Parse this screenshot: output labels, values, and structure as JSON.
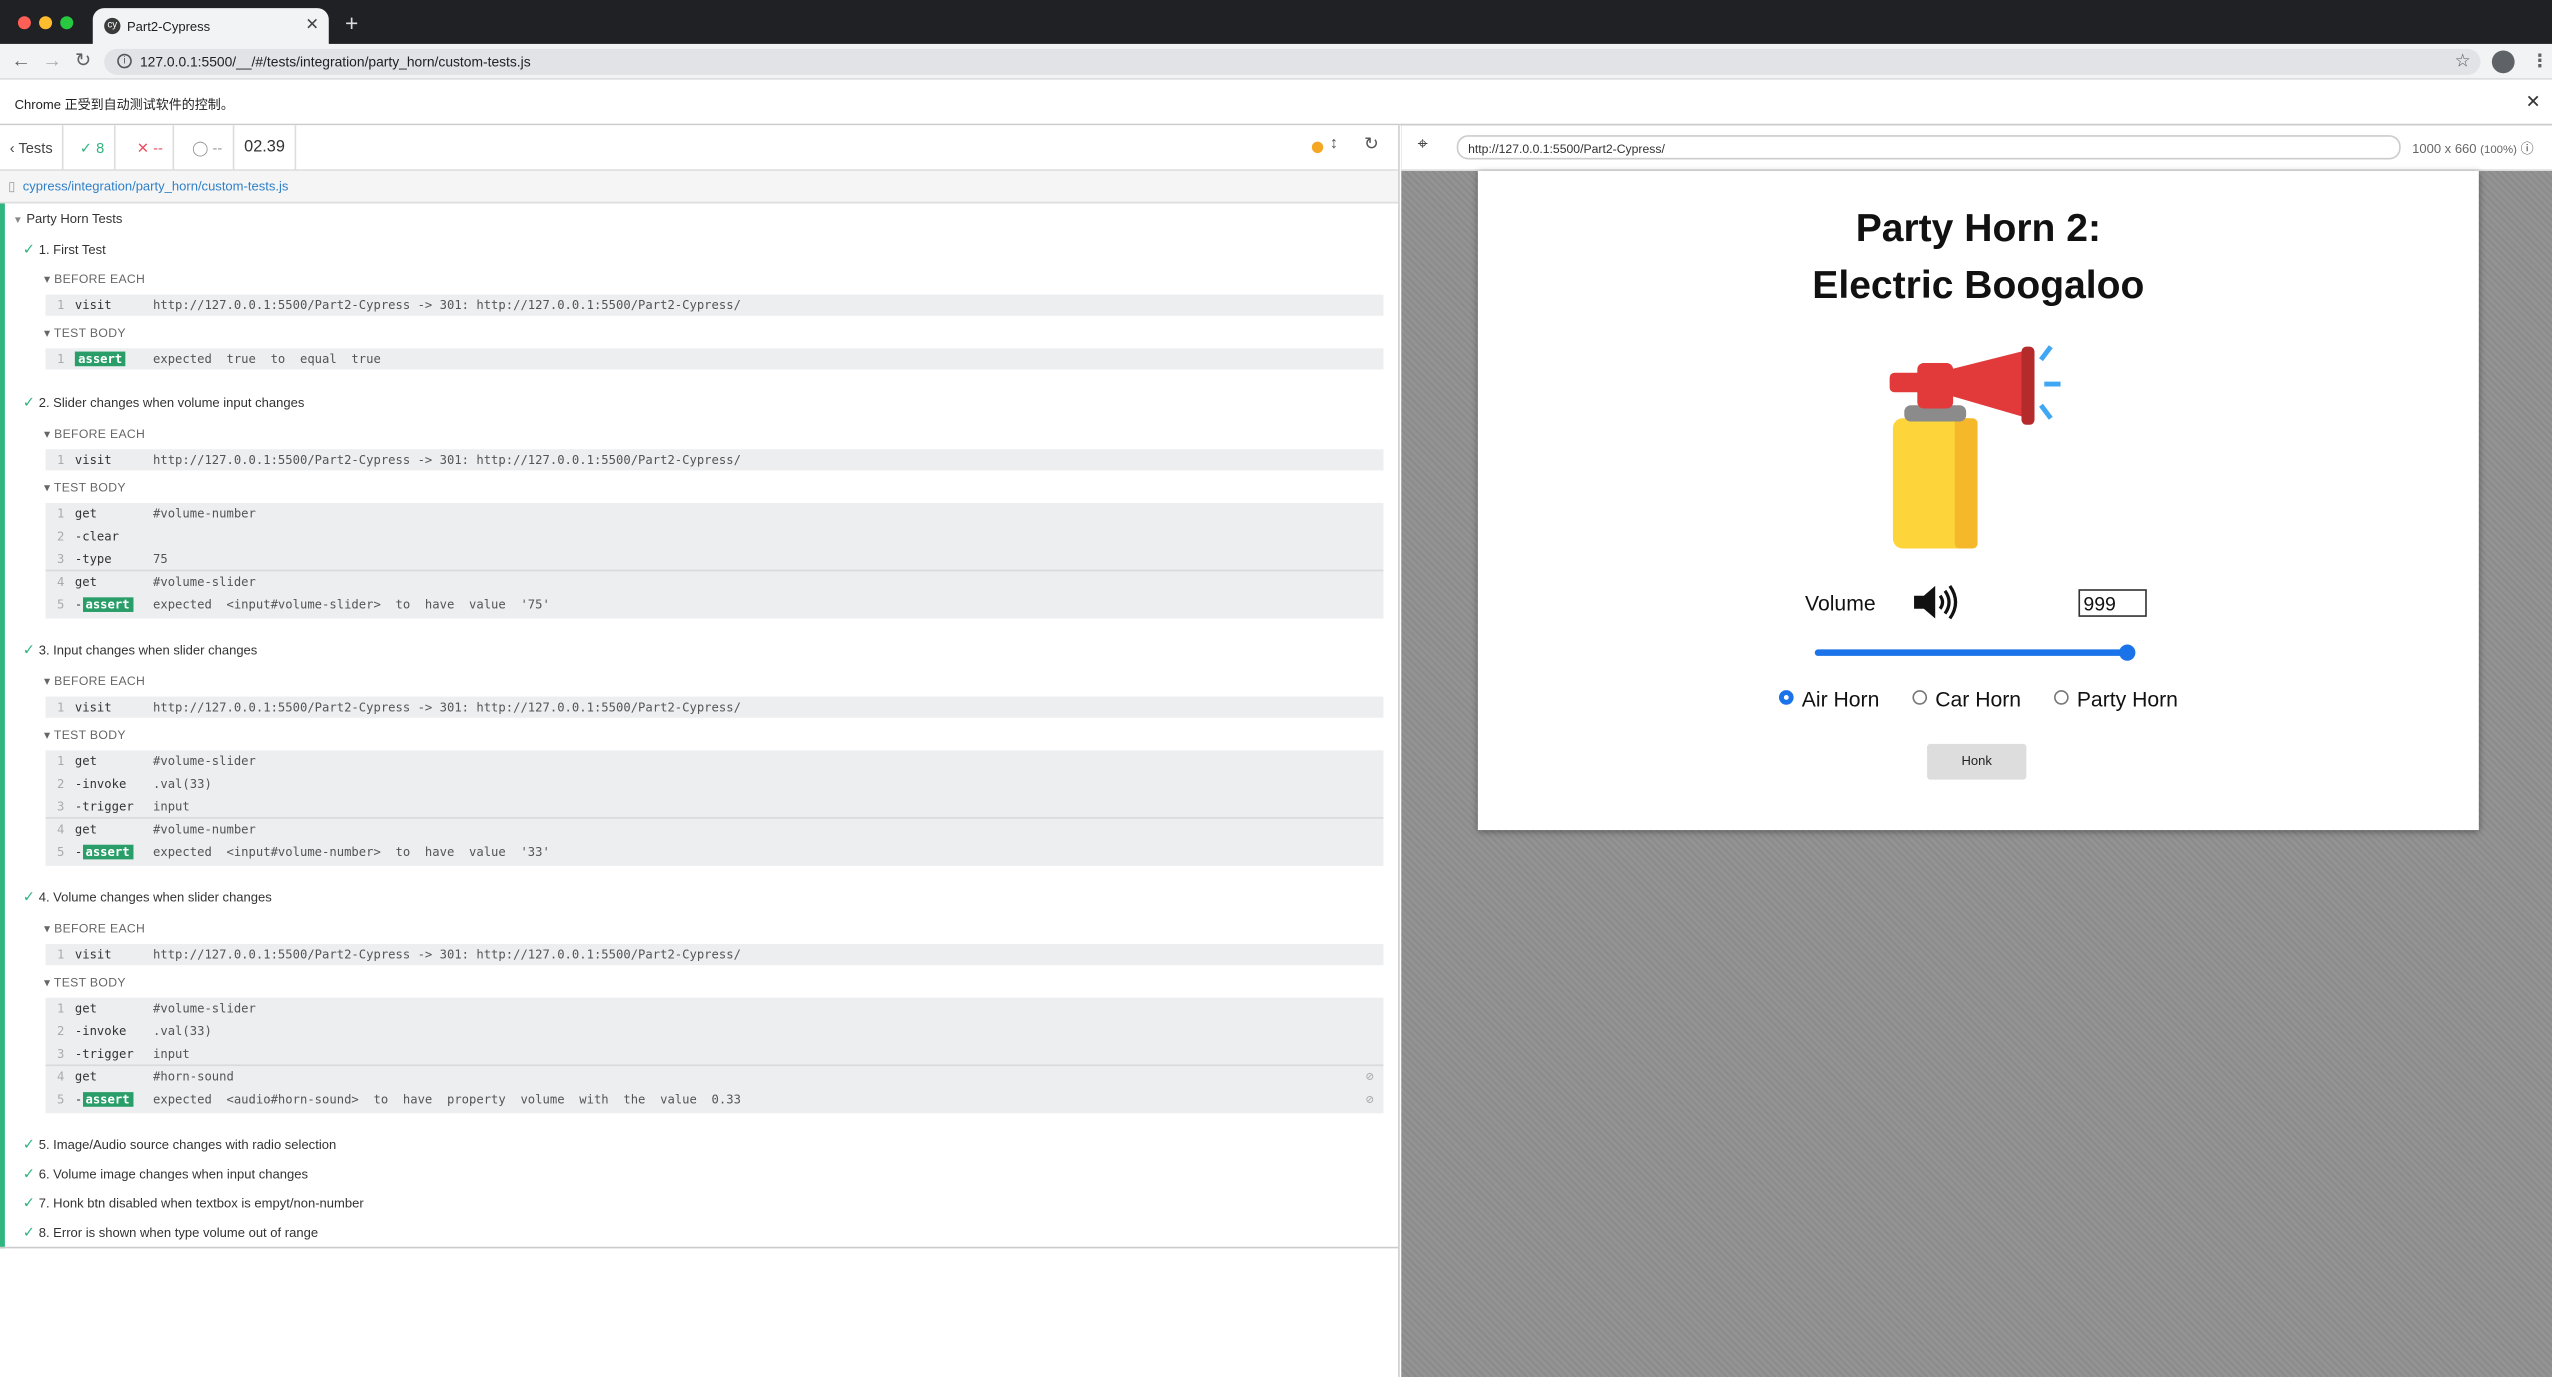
{
  "browser": {
    "tab_title": "Part2-Cypress",
    "tab_favicon": "cy",
    "address": "127.0.0.1:5500/__/#/tests/integration/party_horn/custom-tests.js",
    "infobar": "Chrome 正受到自动测试软件的控制。"
  },
  "reporter": {
    "tests_label": "Tests",
    "passed": "8",
    "failed": "--",
    "pending": "--",
    "duration": "02.39",
    "spec_path": "cypress/integration/party_horn/custom-tests.js",
    "suite": "Party Horn Tests",
    "before_each": "BEFORE EACH",
    "test_body": "TEST BODY",
    "tests": [
      {
        "title": "1. First Test"
      },
      {
        "title": "2. Slider changes when volume input changes"
      },
      {
        "title": "3. Input changes when slider changes"
      },
      {
        "title": "4. Volume changes when slider changes"
      },
      {
        "title": "5. Image/Audio source changes with radio selection"
      },
      {
        "title": "6. Volume image changes when input changes"
      },
      {
        "title": "7. Honk btn disabled when textbox is empyt/non-number"
      },
      {
        "title": "8. Error is shown when type volume out of range"
      }
    ],
    "visit_msg": "http://127.0.0.1:5500/Part2-Cypress -> 301: http://127.0.0.1:5500/Part2-Cypress/",
    "cmds": {
      "visit": "visit",
      "get": "get",
      "clear": "-clear",
      "type": "-type",
      "invoke": "-invoke",
      "trigger": "-trigger",
      "assert": "assert",
      "dash": "-"
    },
    "t1": {
      "assert_msg": "expected  true  to  equal  true"
    },
    "t2": {
      "sel1": "#volume-number",
      "type_val": "75",
      "sel2": "#volume-slider",
      "assert_msg": "expected  <input#volume-slider>  to  have  value  '75'"
    },
    "t3": {
      "sel1": "#volume-slider",
      "invoke_val": ".val(33)",
      "trigger_val": "input",
      "sel2": "#volume-number",
      "assert_msg": "expected  <input#volume-number>  to  have  value  '33'"
    },
    "t4": {
      "sel1": "#volume-slider",
      "invoke_val": ".val(33)",
      "trigger_val": "input",
      "sel2": "#horn-sound",
      "assert_msg": "expected  <audio#horn-sound>  to  have  property  volume  with  the  value  0.33"
    }
  },
  "aut": {
    "url": "http://127.0.0.1:5500/Part2-Cypress/",
    "viewport": "1000 x 660",
    "zoom": "(100%)",
    "title_line1": "Party Horn 2:",
    "title_line2": "Electric Boogaloo",
    "volume_label": "Volume",
    "volume_value": "999",
    "slider_level": 1.0,
    "radios": [
      "Air Horn",
      "Car Horn",
      "Party Horn"
    ],
    "selected_radio": "Air Horn",
    "honk_label": "Honk"
  }
}
